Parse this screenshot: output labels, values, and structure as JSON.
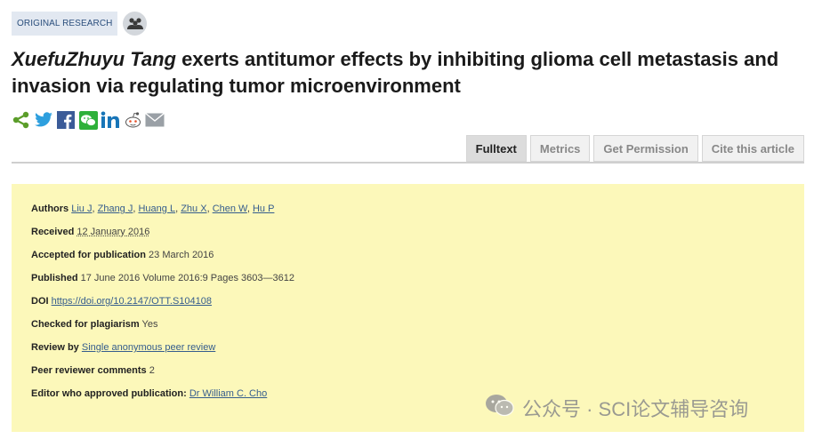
{
  "header": {
    "badge": "ORIGINAL RESEARCH"
  },
  "title": {
    "italic": "XuefuZhuyu Tang",
    "rest": " exerts antitumor effects by inhibiting glioma cell metastasis and invasion via regulating tumor microenvironment"
  },
  "share_icons": [
    "share-icon",
    "twitter-icon",
    "facebook-icon",
    "wechat-icon",
    "linkedin-icon",
    "reddit-icon",
    "email-icon"
  ],
  "tabs": [
    "Fulltext",
    "Metrics",
    "Get Permission",
    "Cite this article"
  ],
  "meta": {
    "authors_label": "Authors",
    "authors": [
      "Liu J",
      "Zhang J",
      "Huang L",
      "Zhu X",
      "Chen W",
      "Hu P"
    ],
    "received_label": "Received",
    "received": "12 January 2016",
    "accepted_label": "Accepted for publication",
    "accepted": "23 March 2016",
    "published_label": "Published",
    "published": "17 June 2016 Volume 2016:9 Pages 3603—3612",
    "doi_label": "DOI",
    "doi": "https://doi.org/10.2147/OTT.S104108",
    "plagiarism_label": "Checked for plagiarism",
    "plagiarism": "Yes",
    "review_label": "Review by",
    "review": "Single anonymous peer review",
    "comments_label": "Peer reviewer comments",
    "comments": "2",
    "editor_label": "Editor who approved publication:",
    "editor": "Dr William C. Cho"
  },
  "watermark": "公众号 · SCI论文辅导咨询",
  "colors": {
    "meta_bg": "#fcf8ba",
    "badge_bg": "#e2e8f1",
    "link": "#355d8d",
    "share_green": "#5b9d2a"
  }
}
